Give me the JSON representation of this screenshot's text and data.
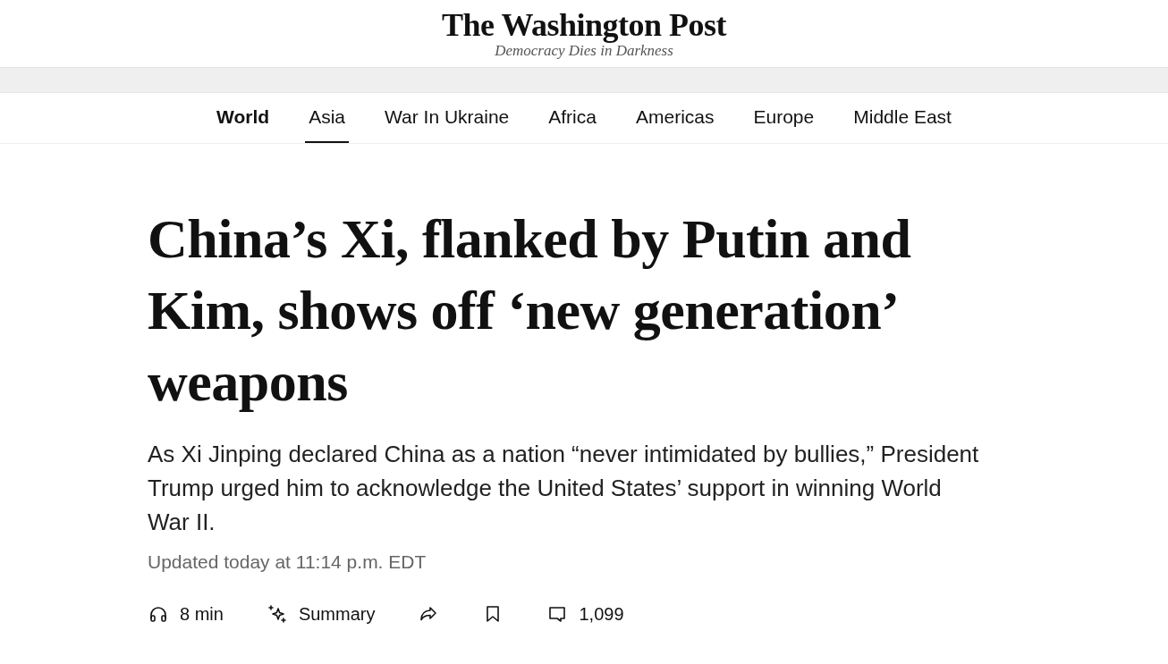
{
  "masthead": {
    "title": "The Washington Post",
    "tagline": "Democracy Dies in Darkness"
  },
  "nav": [
    {
      "label": "World",
      "kind": "section",
      "selected": false
    },
    {
      "label": "Asia",
      "kind": "link",
      "selected": true
    },
    {
      "label": "War In Ukraine",
      "kind": "link",
      "selected": false
    },
    {
      "label": "Africa",
      "kind": "link",
      "selected": false
    },
    {
      "label": "Americas",
      "kind": "link",
      "selected": false
    },
    {
      "label": "Europe",
      "kind": "link",
      "selected": false
    },
    {
      "label": "Middle East",
      "kind": "link",
      "selected": false
    }
  ],
  "article": {
    "headline": "China’s Xi, flanked by Putin and Kim, shows off ‘new generation’ weapons",
    "dek": "As Xi Jinping declared China as a nation “never intimidated by bullies,” President Trump urged him to acknowledge the United States’ support in winning World War II.",
    "timestamp": "Updated today at 11:14 p.m. EDT",
    "actions": [
      {
        "kind": "listen",
        "label": "8 min"
      },
      {
        "kind": "summary",
        "label": "Summary"
      },
      {
        "kind": "share"
      },
      {
        "kind": "save"
      },
      {
        "kind": "comments",
        "label": "1,099"
      }
    ]
  }
}
